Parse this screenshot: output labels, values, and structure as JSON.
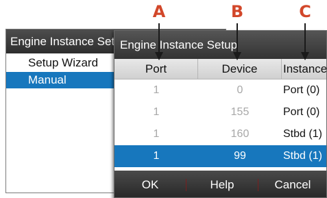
{
  "callouts": [
    "A",
    "B",
    "C"
  ],
  "colors": {
    "callout": "#d2472a",
    "selection": "#1777bd",
    "titlebar": "#3a3a3a"
  },
  "back_window": {
    "title": "Engine Instance Setup",
    "items": [
      {
        "label": "Setup Wizard",
        "selected": false
      },
      {
        "label": "Manual",
        "selected": true
      }
    ]
  },
  "dialog": {
    "title": "Engine Instance Setup",
    "columns": [
      "Port",
      "Device",
      "Instance"
    ],
    "rows": [
      {
        "port": "1",
        "device": "0",
        "instance": "Port (0)",
        "selected": false
      },
      {
        "port": "1",
        "device": "155",
        "instance": "Port (0)",
        "selected": false
      },
      {
        "port": "1",
        "device": "160",
        "instance": "Stbd (1)",
        "selected": false
      },
      {
        "port": "1",
        "device": "99",
        "instance": "Stbd (1)",
        "selected": true
      }
    ],
    "buttons": {
      "ok": "OK",
      "help": "Help",
      "cancel": "Cancel"
    }
  }
}
